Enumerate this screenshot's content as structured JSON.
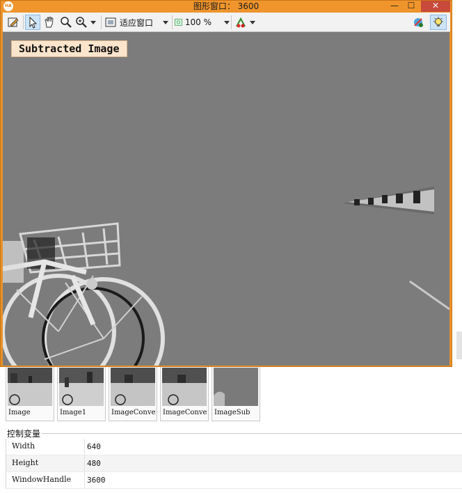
{
  "window": {
    "logo_text": "HA",
    "title": "图形窗口： 3600",
    "controls": {
      "minimize": "—",
      "maximize": "☐",
      "close": "✕"
    }
  },
  "toolbar": {
    "icons": [
      "pencil-icon",
      "pointer-icon",
      "hand-icon",
      "zoom-icon",
      "zoom-options-icon",
      "fit-window-icon",
      "zoom-percent-icon",
      "color-palette-icon",
      "graphics-settings-icon",
      "lightbulb-icon"
    ],
    "fit_combo": "适应窗口",
    "zoom_combo": "100 %"
  },
  "canvas": {
    "overlay_label": "Subtracted Image"
  },
  "thumbnails": [
    {
      "label": "Image"
    },
    {
      "label": "Image1"
    },
    {
      "label": "ImageConver"
    },
    {
      "label": "ImageConver"
    },
    {
      "label": "ImageSub"
    }
  ],
  "variables": {
    "header": "控制变量",
    "rows": [
      {
        "name": "Width",
        "value": "640"
      },
      {
        "name": "Height",
        "value": "480"
      },
      {
        "name": "WindowHandle",
        "value": "3600"
      }
    ]
  },
  "colors": {
    "window_frame": "#f0952c",
    "label_bg": "#fbe4cc",
    "canvas_bg": "#7a7a7a"
  }
}
